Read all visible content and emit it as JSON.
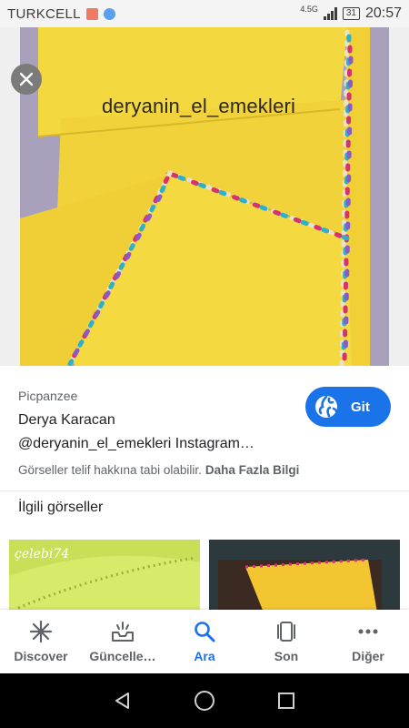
{
  "status_bar": {
    "carrier": "TURKCELL",
    "network": "4.5G",
    "battery": "31",
    "time": "20:57"
  },
  "viewer": {
    "watermark": "deryanin_el_emekleri",
    "close_icon": "close-icon"
  },
  "result": {
    "source": "Picpanzee",
    "title_line1": "Derya Karacan",
    "title_line2": "@deryanin_el_emekleri Instagram…",
    "visit_label": "Git",
    "copyright_text": "Görseller telif hakkına tabi olabilir.",
    "more_info_link": "Daha Fazla Bilgi"
  },
  "related": {
    "heading": "İlgili görseller",
    "thumbs": [
      {
        "watermark": "çelebi74"
      },
      {
        "watermark": ""
      }
    ]
  },
  "bottom_nav": {
    "items": [
      {
        "label": "Discover",
        "icon": "asterisk-icon",
        "active": false
      },
      {
        "label": "Güncelle…",
        "icon": "inbox-icon",
        "active": false
      },
      {
        "label": "Ara",
        "icon": "search-icon",
        "active": true
      },
      {
        "label": "Son",
        "icon": "tabs-icon",
        "active": false
      },
      {
        "label": "Diğer",
        "icon": "more-icon",
        "active": false
      }
    ]
  },
  "colors": {
    "accent": "#1a73e8",
    "fabric": "#f2d43c"
  }
}
